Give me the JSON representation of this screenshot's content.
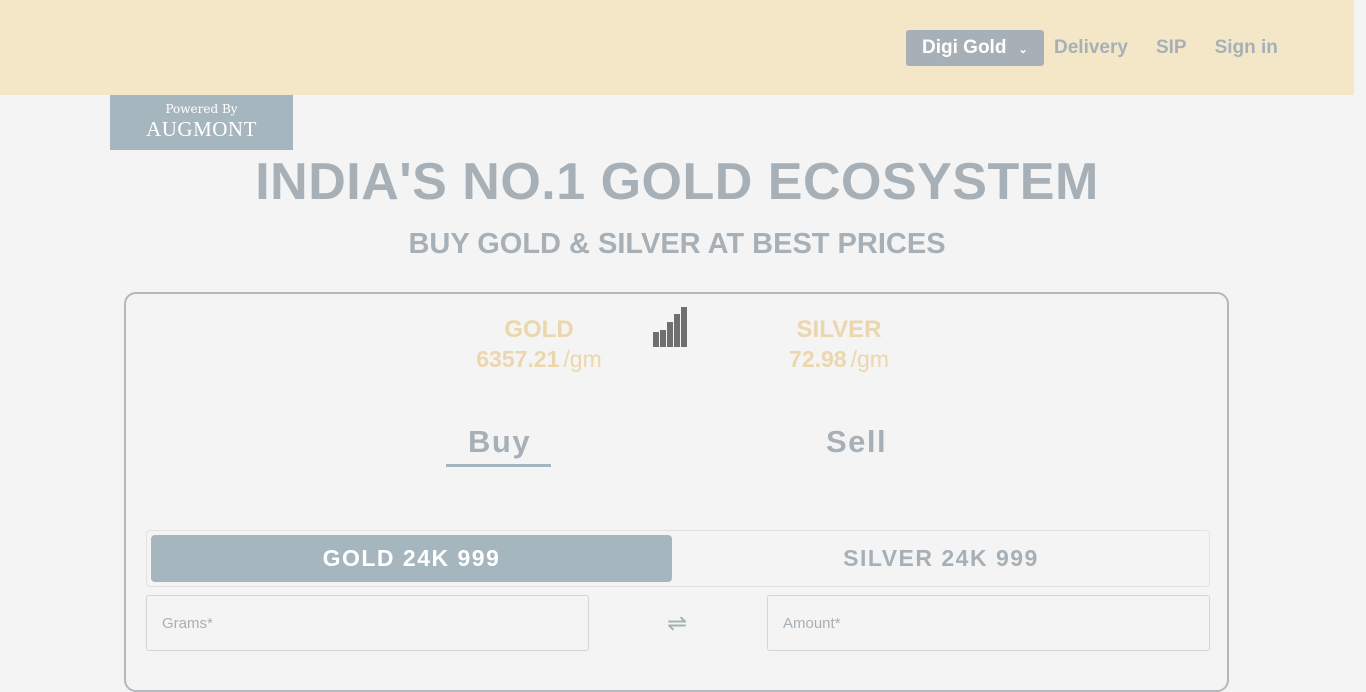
{
  "nav": {
    "dropdown_label": "Digi Gold",
    "links": [
      "Delivery",
      "SIP",
      "Sign in"
    ]
  },
  "powered_by": {
    "label": "Powered By",
    "brand": "AUGMONT"
  },
  "hero": {
    "title": "INDIA'S NO.1 GOLD ECOSYSTEM",
    "subtitle": "BUY GOLD & SILVER AT BEST PRICES"
  },
  "prices": {
    "gold": {
      "metal": "GOLD",
      "value": "6357.21",
      "unit": "/gm"
    },
    "silver": {
      "metal": "SILVER",
      "value": "72.98",
      "unit": "/gm"
    }
  },
  "tabs": {
    "buy": "Buy",
    "sell": "Sell",
    "active": "buy"
  },
  "metal_toggle": {
    "gold": "GOLD 24K 999",
    "silver": "SILVER 24K 999",
    "selected": "gold"
  },
  "form": {
    "grams_placeholder": "Grams*",
    "amount_placeholder": "Amount*"
  },
  "colors": {
    "header_bg": "#f4e7c8",
    "accent_grey": "#a6b6be",
    "price_gold": "#ecd6ad"
  }
}
